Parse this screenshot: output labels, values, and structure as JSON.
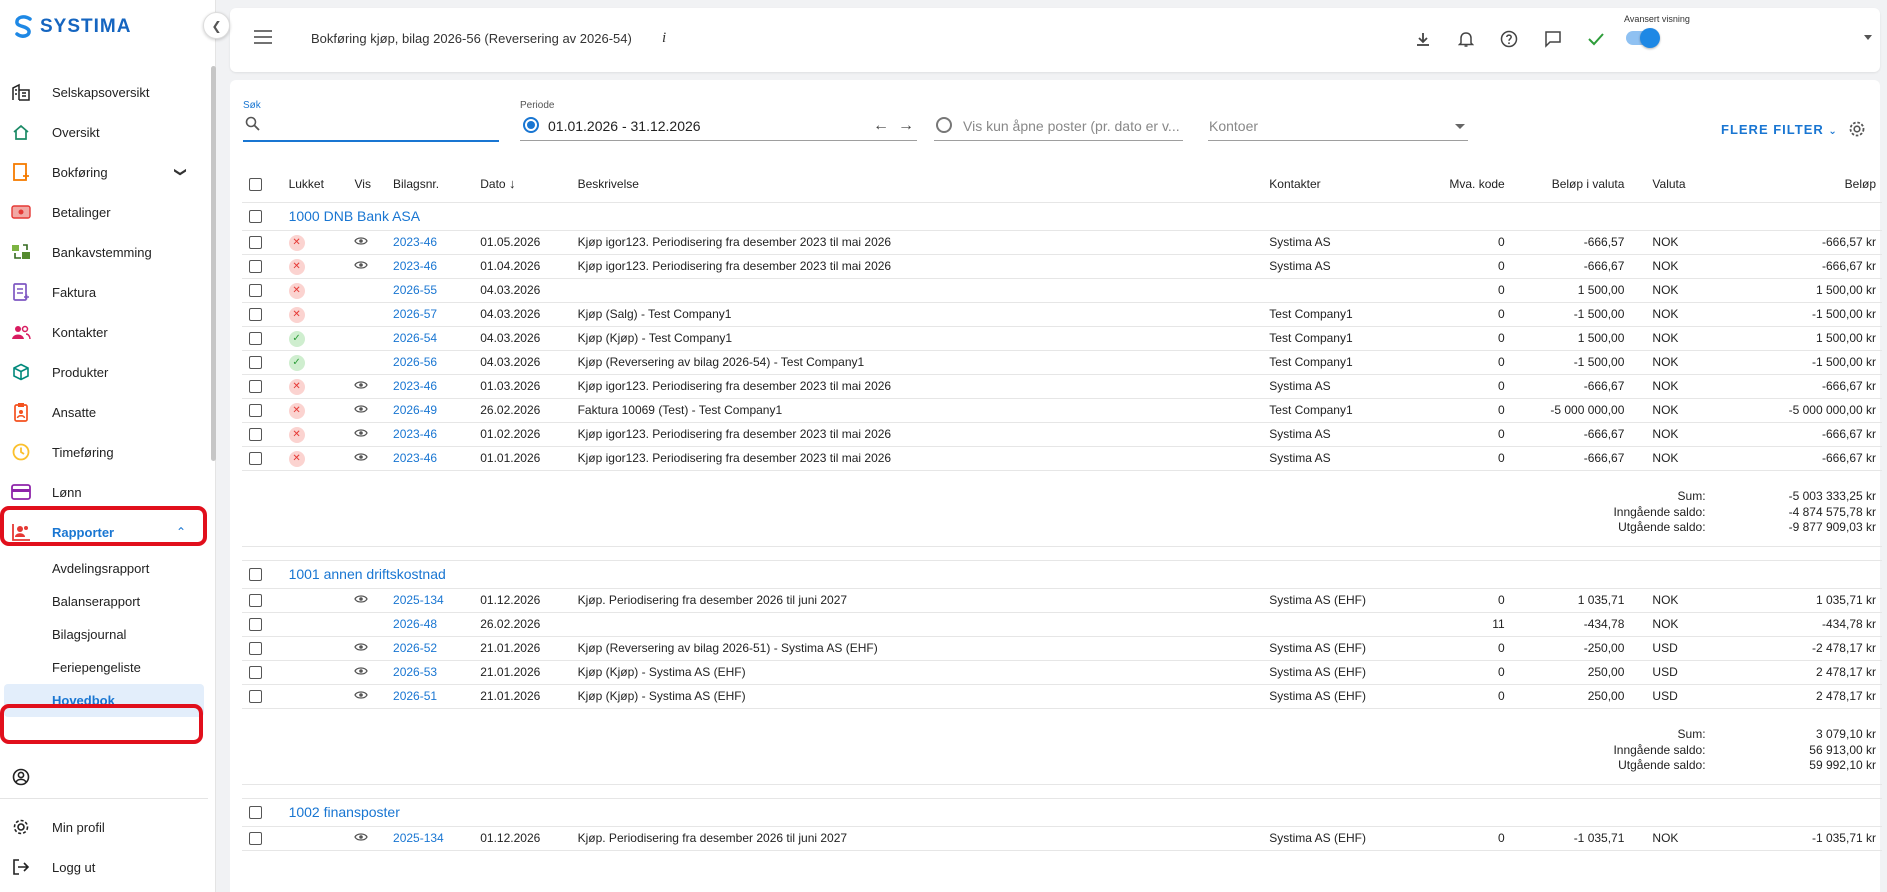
{
  "app": {
    "logo_text": "SYSTIMA"
  },
  "sidebar": {
    "items": [
      {
        "label": "Selskapsoversikt",
        "icon": "building-icon"
      },
      {
        "label": "Oversikt",
        "icon": "home-icon"
      },
      {
        "label": "Bokføring",
        "icon": "bookkeeping-icon"
      },
      {
        "label": "Betalinger",
        "icon": "payments-icon"
      },
      {
        "label": "Bankavstemming",
        "icon": "bank-reconcile-icon"
      },
      {
        "label": "Faktura",
        "icon": "invoice-icon"
      },
      {
        "label": "Kontakter",
        "icon": "contacts-icon"
      },
      {
        "label": "Produkter",
        "icon": "products-icon"
      },
      {
        "label": "Ansatte",
        "icon": "employees-icon"
      },
      {
        "label": "Timeføring",
        "icon": "clock-icon"
      },
      {
        "label": "Lønn",
        "icon": "payroll-icon"
      },
      {
        "label": "Rapporter",
        "icon": "reports-icon"
      }
    ],
    "report_subitems": [
      "Avdelingsrapport",
      "Balanserapport",
      "Bilagsjournal",
      "Feriepengeliste",
      "Hovedbok"
    ],
    "bottom": {
      "profile": "Min profil",
      "logout": "Logg ut"
    }
  },
  "topbar": {
    "breadcrumb": "Bokføring kjøp, bilag 2026-56 (Reversering av 2026-54)",
    "info": "i",
    "advanced_label": "Avansert visning"
  },
  "filters": {
    "search_label": "Søk",
    "period_label": "Periode",
    "period_value": "01.01.2026 - 31.12.2026",
    "open_items_placeholder": "Vis kun åpne poster (pr. dato er v...",
    "accounts_placeholder": "Kontoer",
    "more_filters": "FLERE FILTER"
  },
  "table": {
    "headers": {
      "closed": "Lukket",
      "view": "Vis",
      "voucher": "Bilagsnr.",
      "date": "Dato",
      "description": "Beskrivelse",
      "contacts": "Kontakter",
      "vat": "Mva. kode",
      "amount_currency": "Beløp i valuta",
      "currency": "Valuta",
      "amount": "Beløp"
    },
    "groups": [
      {
        "name": "1000 DNB Bank ASA",
        "rows": [
          {
            "status": "x",
            "eye": true,
            "voucher": "2023-46",
            "date": "01.05.2026",
            "desc": "Kjøp igor123. Periodisering fra desember 2023 til mai 2026",
            "contact": "Systima AS",
            "vat": "0",
            "amount_cur": "-666,57",
            "currency": "NOK",
            "amount": "-666,57 kr"
          },
          {
            "status": "x",
            "eye": true,
            "voucher": "2023-46",
            "date": "01.04.2026",
            "desc": "Kjøp igor123. Periodisering fra desember 2023 til mai 2026",
            "contact": "Systima AS",
            "vat": "0",
            "amount_cur": "-666,67",
            "currency": "NOK",
            "amount": "-666,67 kr"
          },
          {
            "status": "x",
            "eye": false,
            "voucher": "2026-55",
            "date": "04.03.2026",
            "desc": "",
            "contact": "",
            "vat": "0",
            "amount_cur": "1 500,00",
            "currency": "NOK",
            "amount": "1 500,00 kr"
          },
          {
            "status": "x",
            "eye": false,
            "voucher": "2026-57",
            "date": "04.03.2026",
            "desc": "Kjøp (Salg) - Test Company1",
            "contact": "Test Company1",
            "vat": "0",
            "amount_cur": "-1 500,00",
            "currency": "NOK",
            "amount": "-1 500,00 kr"
          },
          {
            "status": "ok",
            "eye": false,
            "voucher": "2026-54",
            "date": "04.03.2026",
            "desc": "Kjøp (Kjøp) - Test Company1",
            "contact": "Test Company1",
            "vat": "0",
            "amount_cur": "1 500,00",
            "currency": "NOK",
            "amount": "1 500,00 kr"
          },
          {
            "status": "ok",
            "eye": false,
            "voucher": "2026-56",
            "date": "04.03.2026",
            "desc": "Kjøp (Reversering av bilag 2026-54) - Test Company1",
            "contact": "Test Company1",
            "vat": "0",
            "amount_cur": "-1 500,00",
            "currency": "NOK",
            "amount": "-1 500,00 kr"
          },
          {
            "status": "x",
            "eye": true,
            "voucher": "2023-46",
            "date": "01.03.2026",
            "desc": "Kjøp igor123. Periodisering fra desember 2023 til mai 2026",
            "contact": "Systima AS",
            "vat": "0",
            "amount_cur": "-666,67",
            "currency": "NOK",
            "amount": "-666,67 kr"
          },
          {
            "status": "x",
            "eye": true,
            "voucher": "2026-49",
            "date": "26.02.2026",
            "desc": "Faktura 10069 (Test) - Test Company1",
            "contact": "Test Company1",
            "vat": "0",
            "amount_cur": "-5 000 000,00",
            "currency": "NOK",
            "amount": "-5 000 000,00 kr"
          },
          {
            "status": "x",
            "eye": true,
            "voucher": "2023-46",
            "date": "01.02.2026",
            "desc": "Kjøp igor123. Periodisering fra desember 2023 til mai 2026",
            "contact": "Systima AS",
            "vat": "0",
            "amount_cur": "-666,67",
            "currency": "NOK",
            "amount": "-666,67 kr"
          },
          {
            "status": "x",
            "eye": true,
            "voucher": "2023-46",
            "date": "01.01.2026",
            "desc": "Kjøp igor123. Periodisering fra desember 2023 til mai 2026",
            "contact": "Systima AS",
            "vat": "0",
            "amount_cur": "-666,67",
            "currency": "NOK",
            "amount": "-666,67 kr"
          }
        ],
        "sum": "-5 003 333,25 kr",
        "opening": "-4 874 575,78 kr",
        "closing": "-9 877 909,03 kr"
      },
      {
        "name": "1001 annen driftskostnad",
        "rows": [
          {
            "status": "",
            "eye": true,
            "voucher": "2025-134",
            "date": "01.12.2026",
            "desc": "Kjøp. Periodisering fra desember 2026 til juni 2027",
            "contact": "Systima AS (EHF)",
            "vat": "0",
            "amount_cur": "1 035,71",
            "currency": "NOK",
            "amount": "1 035,71 kr"
          },
          {
            "status": "",
            "eye": false,
            "voucher": "2026-48",
            "date": "26.02.2026",
            "desc": "",
            "contact": "",
            "vat": "11",
            "amount_cur": "-434,78",
            "currency": "NOK",
            "amount": "-434,78 kr"
          },
          {
            "status": "",
            "eye": true,
            "voucher": "2026-52",
            "date": "21.01.2026",
            "desc": "Kjøp (Reversering av bilag 2026-51) - Systima AS (EHF)",
            "contact": "Systima AS (EHF)",
            "vat": "0",
            "amount_cur": "-250,00",
            "currency": "USD",
            "amount": "-2 478,17 kr"
          },
          {
            "status": "",
            "eye": true,
            "voucher": "2026-53",
            "date": "21.01.2026",
            "desc": "Kjøp (Kjøp) - Systima AS (EHF)",
            "contact": "Systima AS (EHF)",
            "vat": "0",
            "amount_cur": "250,00",
            "currency": "USD",
            "amount": "2 478,17 kr"
          },
          {
            "status": "",
            "eye": true,
            "voucher": "2026-51",
            "date": "21.01.2026",
            "desc": "Kjøp (Kjøp) - Systima AS (EHF)",
            "contact": "Systima AS (EHF)",
            "vat": "0",
            "amount_cur": "250,00",
            "currency": "USD",
            "amount": "2 478,17 kr"
          }
        ],
        "sum": "3 079,10 kr",
        "opening": "56 913,00 kr",
        "closing": "59 992,10 kr"
      },
      {
        "name": "1002 finansposter",
        "rows": [
          {
            "status": "",
            "eye": true,
            "voucher": "2025-134",
            "date": "01.12.2026",
            "desc": "Kjøp. Periodisering fra desember 2026 til juni 2027",
            "contact": "Systima AS (EHF)",
            "vat": "0",
            "amount_cur": "-1 035,71",
            "currency": "NOK",
            "amount": "-1 035,71 kr"
          }
        ]
      }
    ],
    "sum_labels": {
      "sum": "Sum:",
      "opening": "Inngående saldo:",
      "closing": "Utgående saldo:"
    }
  }
}
